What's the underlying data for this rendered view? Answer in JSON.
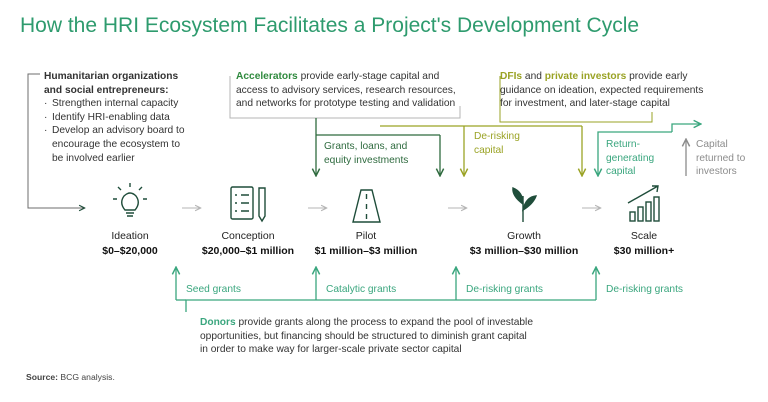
{
  "title": "How the HRI Ecosystem Facilitates a Project's Development Cycle",
  "humanitarian": {
    "heading_1": "Humanitarian organizations",
    "heading_2": "and social entrepreneurs:",
    "items": [
      "Strengthen internal capacity",
      "Identify HRI-enabling data",
      "Develop an advisory board to",
      "encourage the ecosystem to",
      "be involved earlier"
    ]
  },
  "accelerators": {
    "name": "Accelerators",
    "line_1": " provide early-stage capital and",
    "line_2": "access to advisory services, research resources,",
    "line_3": "and networks for prototype testing and validation"
  },
  "investors": {
    "dfis": "DFIs",
    "and": " and ",
    "private": "private investors",
    "line_1": " provide early",
    "line_2": "guidance on ideation, expected requirements",
    "line_3": "for investment, and later-stage capital"
  },
  "flows": {
    "grants_loans": [
      "Grants, loans, and",
      "equity investments"
    ],
    "derisking_capital": [
      "De-risking",
      "capital"
    ],
    "return_generating": [
      "Return-",
      "generating",
      "capital"
    ],
    "capital_returned": [
      "Capital",
      "returned to",
      "investors"
    ]
  },
  "stages": [
    {
      "name": "Ideation",
      "range": "$0–$20,000",
      "icon": "lightbulb-icon"
    },
    {
      "name": "Conception",
      "range": "$20,000–$1 million",
      "icon": "checklist-icon"
    },
    {
      "name": "Pilot",
      "range": "$1 million–$3 million",
      "icon": "road-icon"
    },
    {
      "name": "Growth",
      "range": "$3 million–$30 million",
      "icon": "sprout-icon"
    },
    {
      "name": "Scale",
      "range": "$30 million+",
      "icon": "growth-chart-icon"
    }
  ],
  "grants": [
    "Seed grants",
    "Catalytic grants",
    "De-risking grants",
    "De-risking grants"
  ],
  "donors": {
    "name": "Donors",
    "line_1": " provide grants along the process to expand the pool of investable",
    "line_2": "opportunities, but financing should be structured to diminish grant capital",
    "line_3": "in order to make way for larger-scale private sector capital"
  },
  "source": {
    "label": "Source:",
    "text": " BCG analysis."
  },
  "colors": {
    "title": "#2e9b6e",
    "accelerator_green": "#2f8a3e",
    "investor_olive": "#9aa325",
    "donor_teal": "#3aa67e",
    "connector_gray": "#b5b5b5",
    "return_gray": "#8c8c8c",
    "icon_dark": "#1f4d3a"
  }
}
